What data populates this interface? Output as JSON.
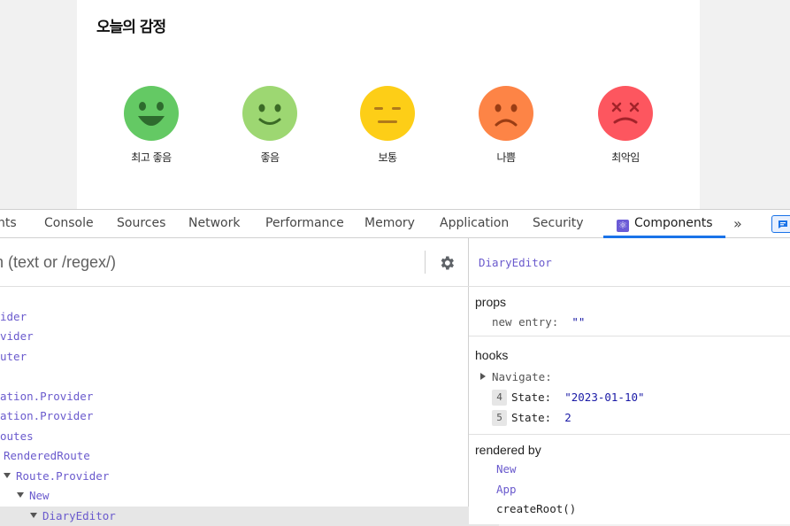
{
  "page": {
    "section_title": "오늘의 감정",
    "emotions": [
      {
        "label": "최고 좋음",
        "color": "#64c964",
        "icon": "very-happy-face-icon"
      },
      {
        "label": "좋음",
        "color": "#9dd772",
        "icon": "happy-face-icon"
      },
      {
        "label": "보통",
        "color": "#fdce17",
        "icon": "neutral-face-icon"
      },
      {
        "label": "나쁨",
        "color": "#fd8446",
        "icon": "sad-face-icon"
      },
      {
        "label": "최악임",
        "color": "#fd565f",
        "icon": "very-bad-face-icon"
      }
    ]
  },
  "devtools": {
    "tabs": [
      "nts",
      "Console",
      "Sources",
      "Network",
      "Performance",
      "Memory",
      "Application",
      "Security",
      "Components"
    ],
    "active_tab": "Components",
    "more_tabs_label": "»",
    "accent": "#1a73e8"
  },
  "tree": {
    "search_placeholder": "n (text or /regex/)",
    "rows": [
      {
        "label": "ider"
      },
      {
        "label": "vider"
      },
      {
        "label": "uter"
      },
      {
        "label": "ation.Provider"
      },
      {
        "label": "ation.Provider"
      },
      {
        "label": "outes"
      },
      {
        "label": "RenderedRoute"
      },
      {
        "label": "Route.Provider"
      },
      {
        "label": "New"
      },
      {
        "label": "DiaryEditor"
      }
    ]
  },
  "inspector": {
    "component_name": "DiaryEditor",
    "props_title": "props",
    "props": [
      {
        "key": "new entry",
        "value": "\"\""
      }
    ],
    "hooks_title": "hooks",
    "hooks": {
      "navigate": "Navigate:",
      "states": [
        {
          "index": "4",
          "name": "State:",
          "value": "\"2023-01-10\""
        },
        {
          "index": "5",
          "name": "State:",
          "value": "2"
        }
      ]
    },
    "rendered_by_title": "rendered by",
    "rendered_by": [
      "New",
      "App",
      "createRoot()"
    ]
  }
}
